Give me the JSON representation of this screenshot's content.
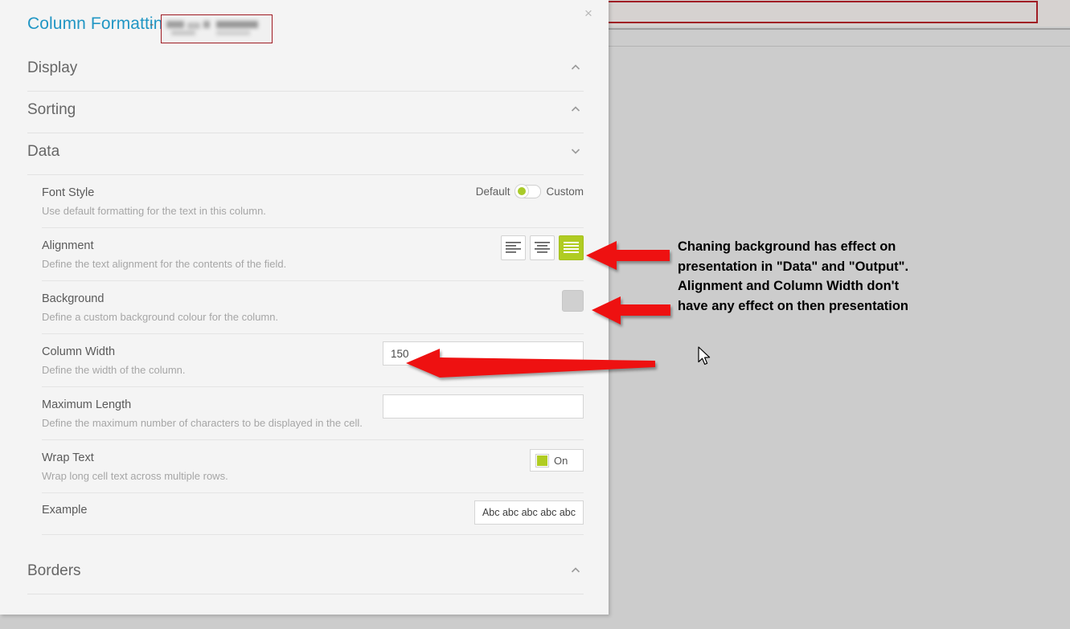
{
  "dialog": {
    "title": "Column Formatting",
    "title_separator": "-",
    "redacted_field_note": "",
    "close_label": "×"
  },
  "sections": [
    {
      "label": "Display",
      "state": "collapsed",
      "chevron": "chevron-up-icon"
    },
    {
      "label": "Sorting",
      "state": "collapsed",
      "chevron": "chevron-up-icon"
    },
    {
      "label": "Data",
      "state": "expanded",
      "chevron": "chevron-down-icon"
    }
  ],
  "borders_section": {
    "label": "Borders",
    "state": "collapsed",
    "chevron": "chevron-up-icon"
  },
  "data_fields": {
    "font_style": {
      "label": "Font Style",
      "description": "Use default formatting for the text in this column.",
      "toggle_left_label": "Default",
      "toggle_right_label": "Custom",
      "selected": "Default"
    },
    "alignment": {
      "label": "Alignment",
      "description": "Define the text alignment for the contents of the field.",
      "options": [
        {
          "name": "align-left-icon",
          "selected": false
        },
        {
          "name": "align-center-icon",
          "selected": false
        },
        {
          "name": "align-justify-icon",
          "selected": true
        }
      ]
    },
    "background": {
      "label": "Background",
      "description": "Define a custom background colour for the column.",
      "swatch_color": "#d0d0d0"
    },
    "column_width": {
      "label": "Column Width",
      "description": "Define the width of the column.",
      "value": "150",
      "placeholder": ""
    },
    "maximum_length": {
      "label": "Maximum Length",
      "description": "Define the maximum number of characters to be displayed in the cell.",
      "value": "",
      "placeholder": ""
    },
    "wrap_text": {
      "label": "Wrap Text",
      "description": "Wrap long cell text across multiple rows.",
      "checkbox_label": "On",
      "checked": true
    },
    "example": {
      "label": "Example",
      "sample_text": "Abc abc abc abc abc"
    }
  },
  "annotation": {
    "text": "Chaning background has effect on\npresentation in \"Data\" and \"Output\".\nAlignment and Column Width don't\nhave any effect on then presentation",
    "arrow_color": "#ee1111",
    "arrows": [
      {
        "name": "arrow-to-alignment",
        "target": "alignment"
      },
      {
        "name": "arrow-to-background",
        "target": "background"
      },
      {
        "name": "arrow-to-column-width",
        "target": "column_width"
      }
    ]
  },
  "background_app": {
    "toolbar_highlight_color": "#a01c24",
    "items": [
      {
        "icon": "yellow-square-icon",
        "label": ""
      },
      {
        "icon": "blue-document-icon",
        "label": ""
      }
    ]
  },
  "colors": {
    "accent_blue": "#2196c4",
    "accent_green": "#b0cc22",
    "annotation_red": "#ee1111",
    "highlight_border": "#a01c24"
  }
}
